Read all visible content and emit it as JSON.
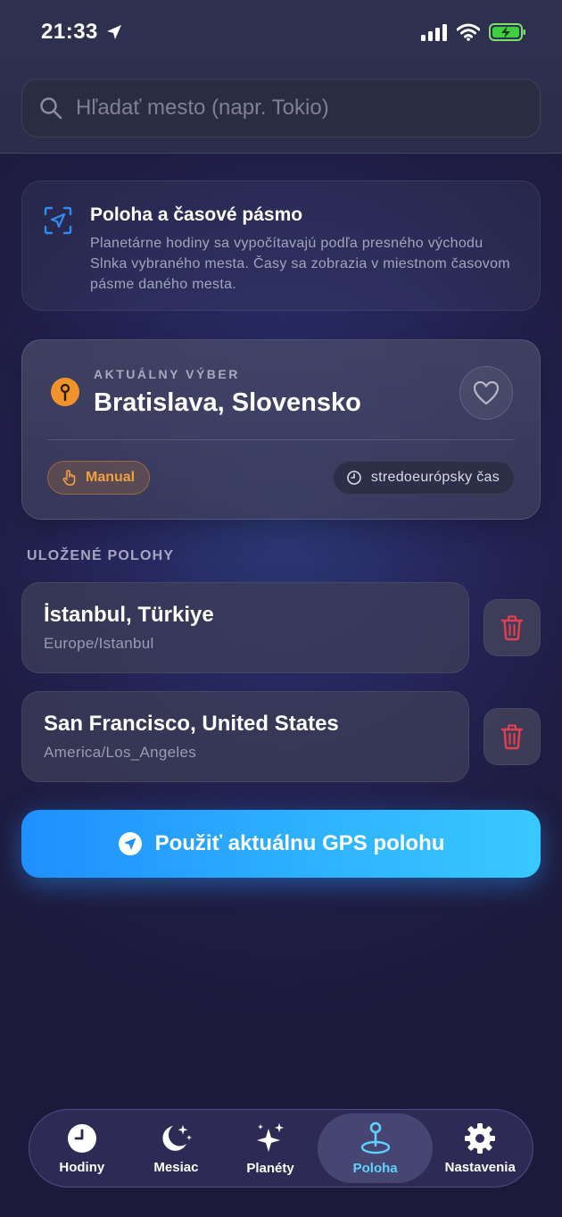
{
  "status_bar": {
    "time": "21:33"
  },
  "search": {
    "placeholder": "Hľadať mesto (napr. Tokio)"
  },
  "info": {
    "title": "Poloha a časové pásmo",
    "text": "Planetárne hodiny sa vypočítavajú podľa presného východu Slnka vybraného mesta. Časy sa zobrazia v miestnom časovom pásme daného mesta."
  },
  "current": {
    "label": "AKTUÁLNY VÝBER",
    "city": "Bratislava, Slovensko",
    "mode": "Manual",
    "timezone": "stredoeurópsky čas"
  },
  "saved": {
    "title": "ULOŽENÉ POLOHY",
    "items": [
      {
        "name": "İstanbul, Türkiye",
        "tz": "Europe/Istanbul"
      },
      {
        "name": "San Francisco, United States",
        "tz": "America/Los_Angeles"
      }
    ]
  },
  "gps_button": {
    "label": "Použiť aktuálnu GPS polohu"
  },
  "tabs": [
    {
      "label": "Hodiny",
      "icon": "clock-icon"
    },
    {
      "label": "Mesiac",
      "icon": "moon-stars-icon"
    },
    {
      "label": "Planéty",
      "icon": "sparkles-icon"
    },
    {
      "label": "Poloha",
      "icon": "location-pin-icon"
    },
    {
      "label": "Nastavenia",
      "icon": "gear-icon"
    }
  ],
  "colors": {
    "accent": "#2fb4ff",
    "orange": "#f0932a",
    "delete": "#e04050",
    "active_tab": "#5fd1ff"
  }
}
